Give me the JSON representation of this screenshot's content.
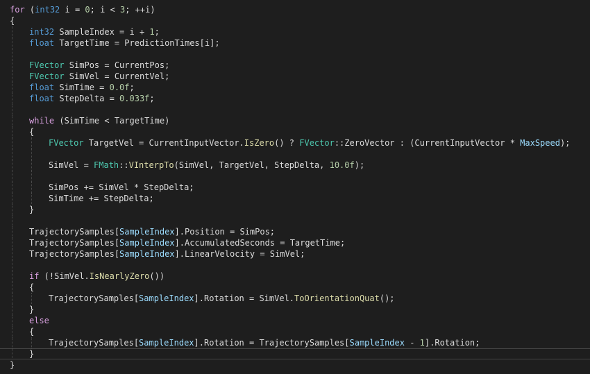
{
  "editor": {
    "language": "C++",
    "colors": {
      "background": "#1e1e1e",
      "keyword": "#569cd6",
      "control": "#d8a0df",
      "type": "#4ec9b0",
      "identifier": "#9cdcfe",
      "function": "#dcdcaa",
      "number": "#b5cea8",
      "plain": "#dcdcdc"
    },
    "current_line_number": 32,
    "lines": [
      {
        "indent": 0,
        "tokens": [
          {
            "t": "ctl",
            "s": "for"
          },
          {
            "t": "plain",
            "s": " ("
          },
          {
            "t": "kw",
            "s": "int32"
          },
          {
            "t": "plain",
            "s": " i = "
          },
          {
            "t": "num",
            "s": "0"
          },
          {
            "t": "plain",
            "s": "; i < "
          },
          {
            "t": "num",
            "s": "3"
          },
          {
            "t": "plain",
            "s": "; ++i)"
          }
        ]
      },
      {
        "indent": 0,
        "tokens": [
          {
            "t": "plain",
            "s": "{"
          }
        ]
      },
      {
        "indent": 1,
        "tokens": [
          {
            "t": "kw",
            "s": "int32"
          },
          {
            "t": "plain",
            "s": " SampleIndex = i + "
          },
          {
            "t": "num",
            "s": "1"
          },
          {
            "t": "plain",
            "s": ";"
          }
        ]
      },
      {
        "indent": 1,
        "tokens": [
          {
            "t": "kw",
            "s": "float"
          },
          {
            "t": "plain",
            "s": " TargetTime = PredictionTimes[i];"
          }
        ]
      },
      {
        "indent": 1,
        "tokens": []
      },
      {
        "indent": 1,
        "tokens": [
          {
            "t": "type",
            "s": "FVector"
          },
          {
            "t": "plain",
            "s": " SimPos = CurrentPos;"
          }
        ]
      },
      {
        "indent": 1,
        "tokens": [
          {
            "t": "type",
            "s": "FVector"
          },
          {
            "t": "plain",
            "s": " SimVel = CurrentVel;"
          }
        ]
      },
      {
        "indent": 1,
        "tokens": [
          {
            "t": "kw",
            "s": "float"
          },
          {
            "t": "plain",
            "s": " SimTime = "
          },
          {
            "t": "num",
            "s": "0.0f"
          },
          {
            "t": "plain",
            "s": ";"
          }
        ]
      },
      {
        "indent": 1,
        "tokens": [
          {
            "t": "kw",
            "s": "float"
          },
          {
            "t": "plain",
            "s": " StepDelta = "
          },
          {
            "t": "num",
            "s": "0.033f"
          },
          {
            "t": "plain",
            "s": ";"
          }
        ]
      },
      {
        "indent": 1,
        "tokens": []
      },
      {
        "indent": 1,
        "tokens": [
          {
            "t": "ctl",
            "s": "while"
          },
          {
            "t": "plain",
            "s": " (SimTime < TargetTime)"
          }
        ]
      },
      {
        "indent": 1,
        "tokens": [
          {
            "t": "plain",
            "s": "{"
          }
        ]
      },
      {
        "indent": 2,
        "tokens": [
          {
            "t": "type",
            "s": "FVector"
          },
          {
            "t": "plain",
            "s": " TargetVel = CurrentInputVector."
          },
          {
            "t": "fn",
            "s": "IsZero"
          },
          {
            "t": "plain",
            "s": "() ? "
          },
          {
            "t": "type",
            "s": "FVector"
          },
          {
            "t": "plain",
            "s": "::ZeroVector : (CurrentInputVector * "
          },
          {
            "t": "id",
            "s": "MaxSpeed"
          },
          {
            "t": "plain",
            "s": ");"
          }
        ]
      },
      {
        "indent": 2,
        "tokens": []
      },
      {
        "indent": 2,
        "tokens": [
          {
            "t": "plain",
            "s": "SimVel = "
          },
          {
            "t": "type",
            "s": "FMath"
          },
          {
            "t": "plain",
            "s": "::"
          },
          {
            "t": "fn",
            "s": "VInterpTo"
          },
          {
            "t": "plain",
            "s": "(SimVel, TargetVel, StepDelta, "
          },
          {
            "t": "num",
            "s": "10.0f"
          },
          {
            "t": "plain",
            "s": ");"
          }
        ]
      },
      {
        "indent": 2,
        "tokens": []
      },
      {
        "indent": 2,
        "tokens": [
          {
            "t": "plain",
            "s": "SimPos += SimVel * StepDelta;"
          }
        ]
      },
      {
        "indent": 2,
        "tokens": [
          {
            "t": "plain",
            "s": "SimTime += StepDelta;"
          }
        ]
      },
      {
        "indent": 1,
        "tokens": [
          {
            "t": "plain",
            "s": "}"
          }
        ]
      },
      {
        "indent": 1,
        "tokens": []
      },
      {
        "indent": 1,
        "tokens": [
          {
            "t": "plain",
            "s": "TrajectorySamples["
          },
          {
            "t": "id",
            "s": "SampleIndex"
          },
          {
            "t": "plain",
            "s": "].Position = SimPos;"
          }
        ]
      },
      {
        "indent": 1,
        "tokens": [
          {
            "t": "plain",
            "s": "TrajectorySamples["
          },
          {
            "t": "id",
            "s": "SampleIndex"
          },
          {
            "t": "plain",
            "s": "].AccumulatedSeconds = TargetTime;"
          }
        ]
      },
      {
        "indent": 1,
        "tokens": [
          {
            "t": "plain",
            "s": "TrajectorySamples["
          },
          {
            "t": "id",
            "s": "SampleIndex"
          },
          {
            "t": "plain",
            "s": "].LinearVelocity = SimVel;"
          }
        ]
      },
      {
        "indent": 1,
        "tokens": []
      },
      {
        "indent": 1,
        "tokens": [
          {
            "t": "ctl",
            "s": "if"
          },
          {
            "t": "plain",
            "s": " (!SimVel."
          },
          {
            "t": "fn",
            "s": "IsNearlyZero"
          },
          {
            "t": "plain",
            "s": "())"
          }
        ]
      },
      {
        "indent": 1,
        "tokens": [
          {
            "t": "plain",
            "s": "{"
          }
        ]
      },
      {
        "indent": 2,
        "tokens": [
          {
            "t": "plain",
            "s": "TrajectorySamples["
          },
          {
            "t": "id",
            "s": "SampleIndex"
          },
          {
            "t": "plain",
            "s": "].Rotation = SimVel."
          },
          {
            "t": "fn",
            "s": "ToOrientationQuat"
          },
          {
            "t": "plain",
            "s": "();"
          }
        ]
      },
      {
        "indent": 1,
        "tokens": [
          {
            "t": "plain",
            "s": "}"
          }
        ]
      },
      {
        "indent": 1,
        "tokens": [
          {
            "t": "ctl",
            "s": "else"
          }
        ]
      },
      {
        "indent": 1,
        "tokens": [
          {
            "t": "plain",
            "s": "{"
          }
        ]
      },
      {
        "indent": 2,
        "tokens": [
          {
            "t": "plain",
            "s": "TrajectorySamples["
          },
          {
            "t": "id",
            "s": "SampleIndex"
          },
          {
            "t": "plain",
            "s": "].Rotation = TrajectorySamples["
          },
          {
            "t": "id",
            "s": "SampleIndex"
          },
          {
            "t": "plain",
            "s": " - "
          },
          {
            "t": "num",
            "s": "1"
          },
          {
            "t": "plain",
            "s": "].Rotation;"
          }
        ]
      },
      {
        "indent": 1,
        "tokens": [
          {
            "t": "plain",
            "s": "}"
          }
        ]
      },
      {
        "indent": 0,
        "tokens": [
          {
            "t": "plain",
            "s": "}"
          }
        ]
      }
    ]
  }
}
